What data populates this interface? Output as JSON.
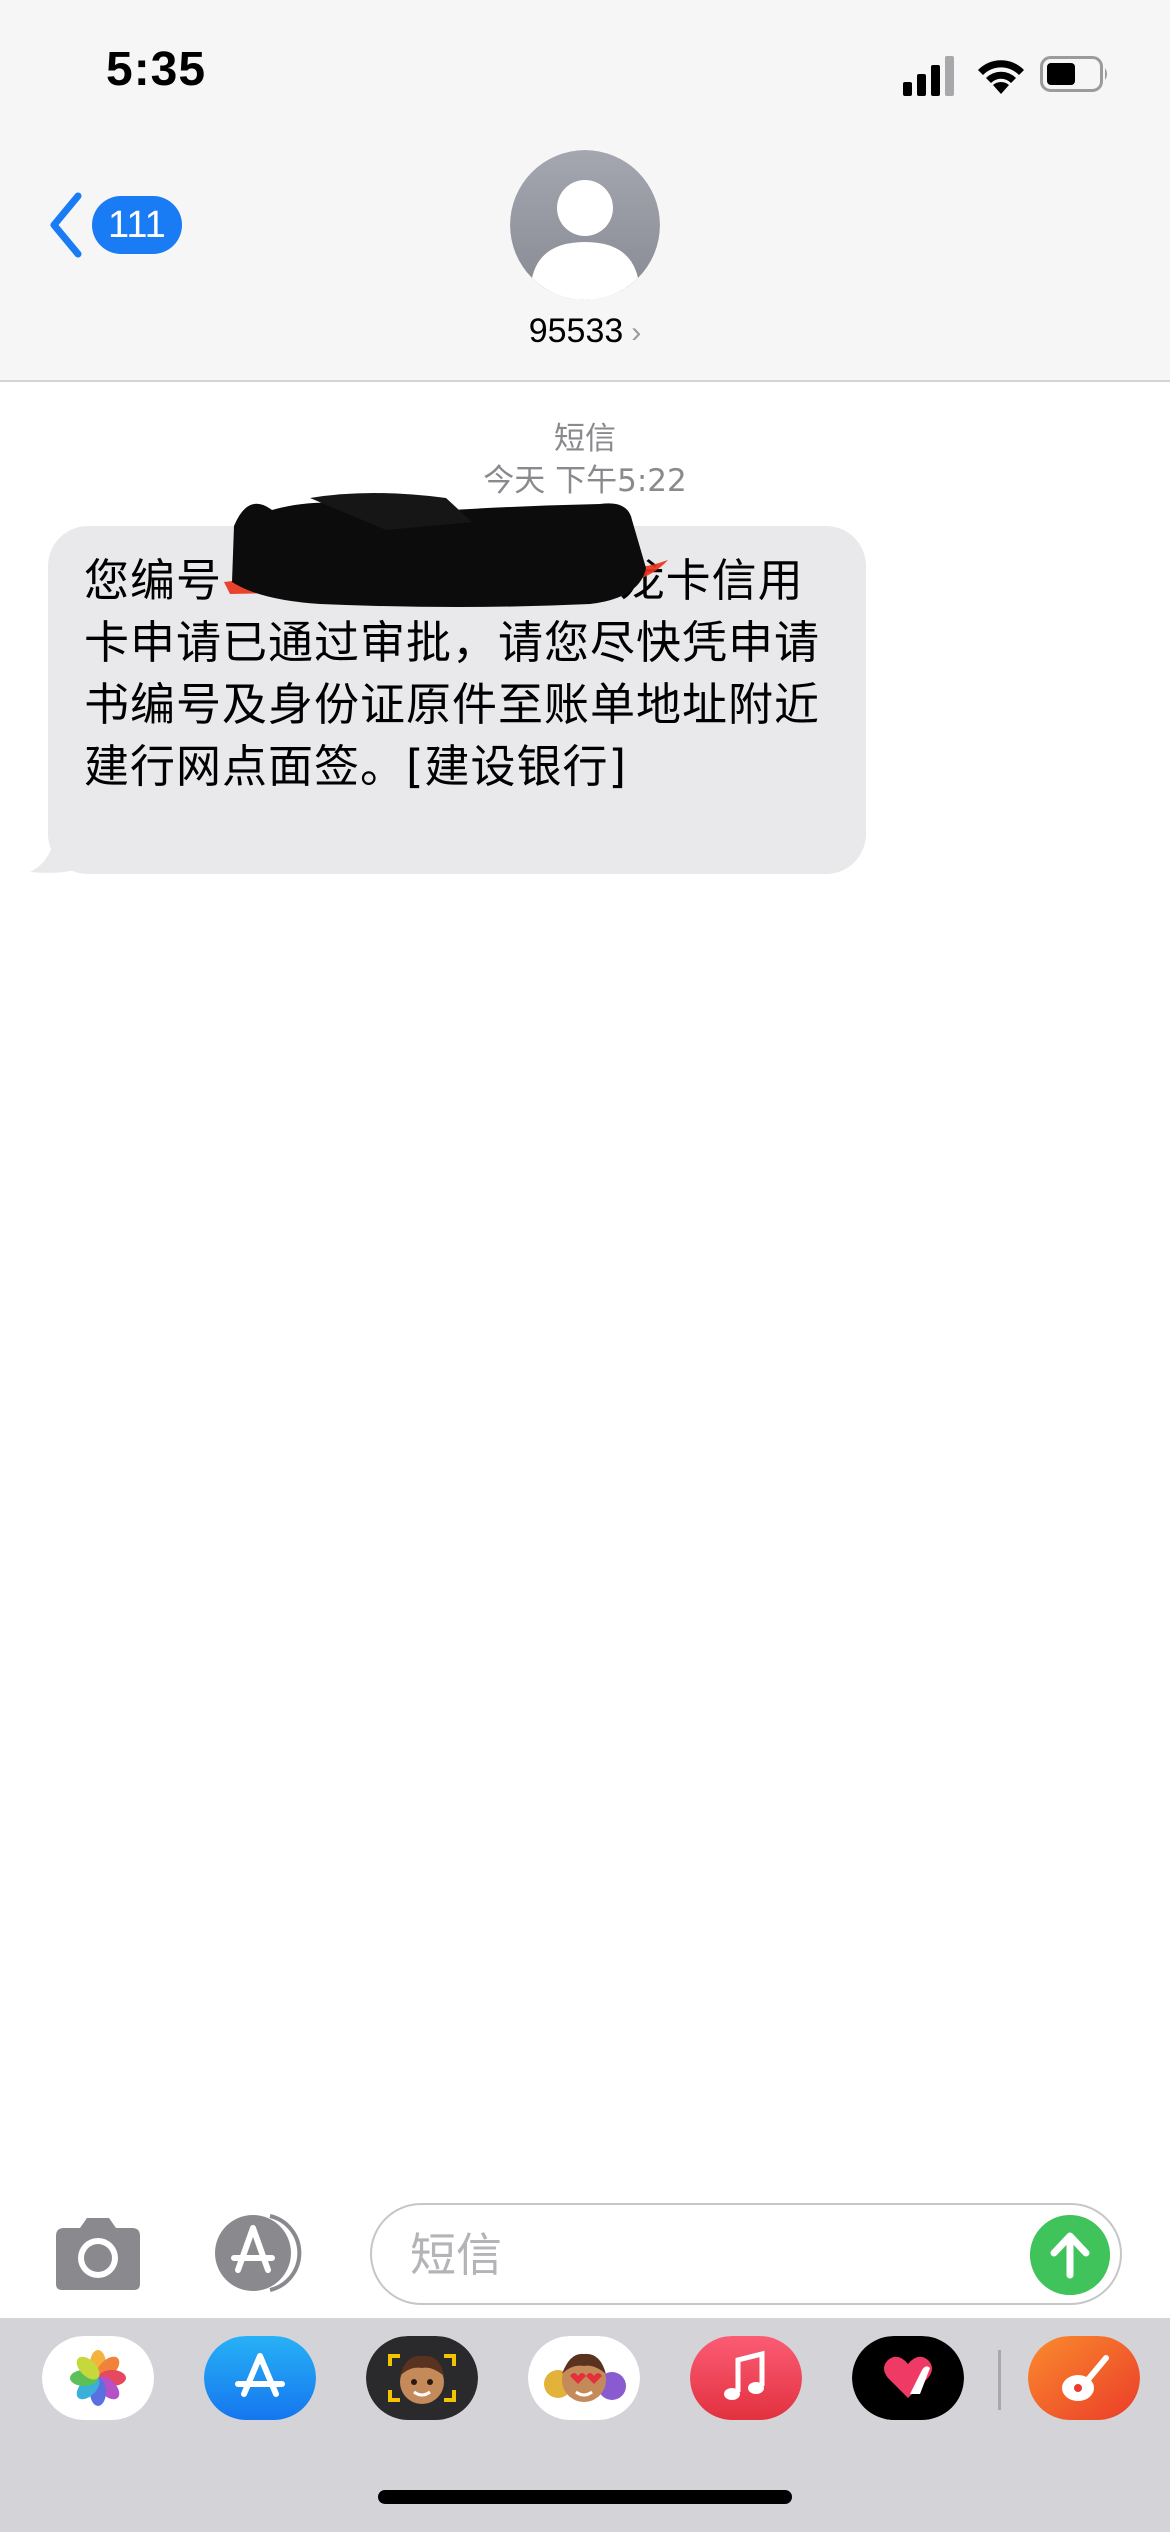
{
  "status_bar": {
    "time": "5:35"
  },
  "nav": {
    "back_badge": "111",
    "contact": "95533",
    "contact_chevron": "›"
  },
  "conversation": {
    "service_label": "短信",
    "timestamp": "今天 下午5:22",
    "message_text": "您编号　　　　　　　6的龙卡信用卡申请已通过审批，请您尽快凭申请书编号及身份证原件至账单地址附近建行网点面签。[建设银行]"
  },
  "input": {
    "placeholder": "短信"
  },
  "app_strip": {
    "apps": [
      "photos-icon",
      "appstore-icon",
      "memoji-camera-icon",
      "memoji-stickers-icon",
      "music-icon",
      "digital-touch-icon",
      "garageband-icon"
    ]
  },
  "colors": {
    "accent_blue": "#1a7cf5",
    "send_green": "#3fc35a",
    "bubble_gray": "#e9e9eb",
    "header_bg": "#f6f6f6",
    "strip_bg": "#d3d3d8"
  }
}
